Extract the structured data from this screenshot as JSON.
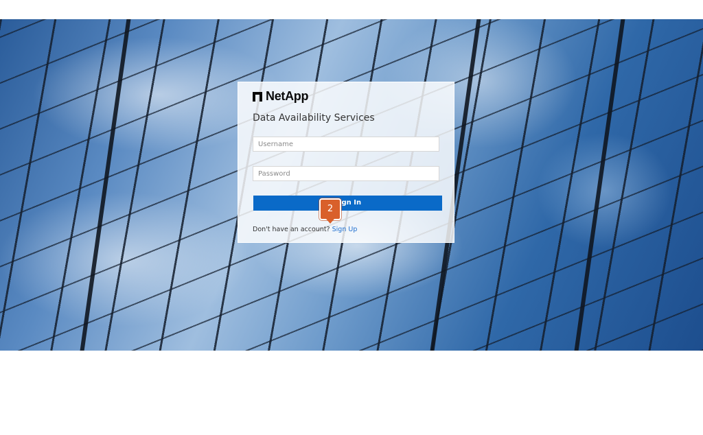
{
  "brand": {
    "name": "NetApp",
    "logo_icon": "netapp-logo-icon"
  },
  "login": {
    "title": "Data Availability Services",
    "username_placeholder": "Username",
    "password_placeholder": "Password",
    "signin_label": "Sign In",
    "signup_prompt": "Don't have an account?",
    "signup_link": "Sign Up"
  },
  "step_badge": {
    "number": "2",
    "color": "#d9602b"
  },
  "colors": {
    "primary_button": "#0a6ac8",
    "link": "#1f6fd0"
  }
}
